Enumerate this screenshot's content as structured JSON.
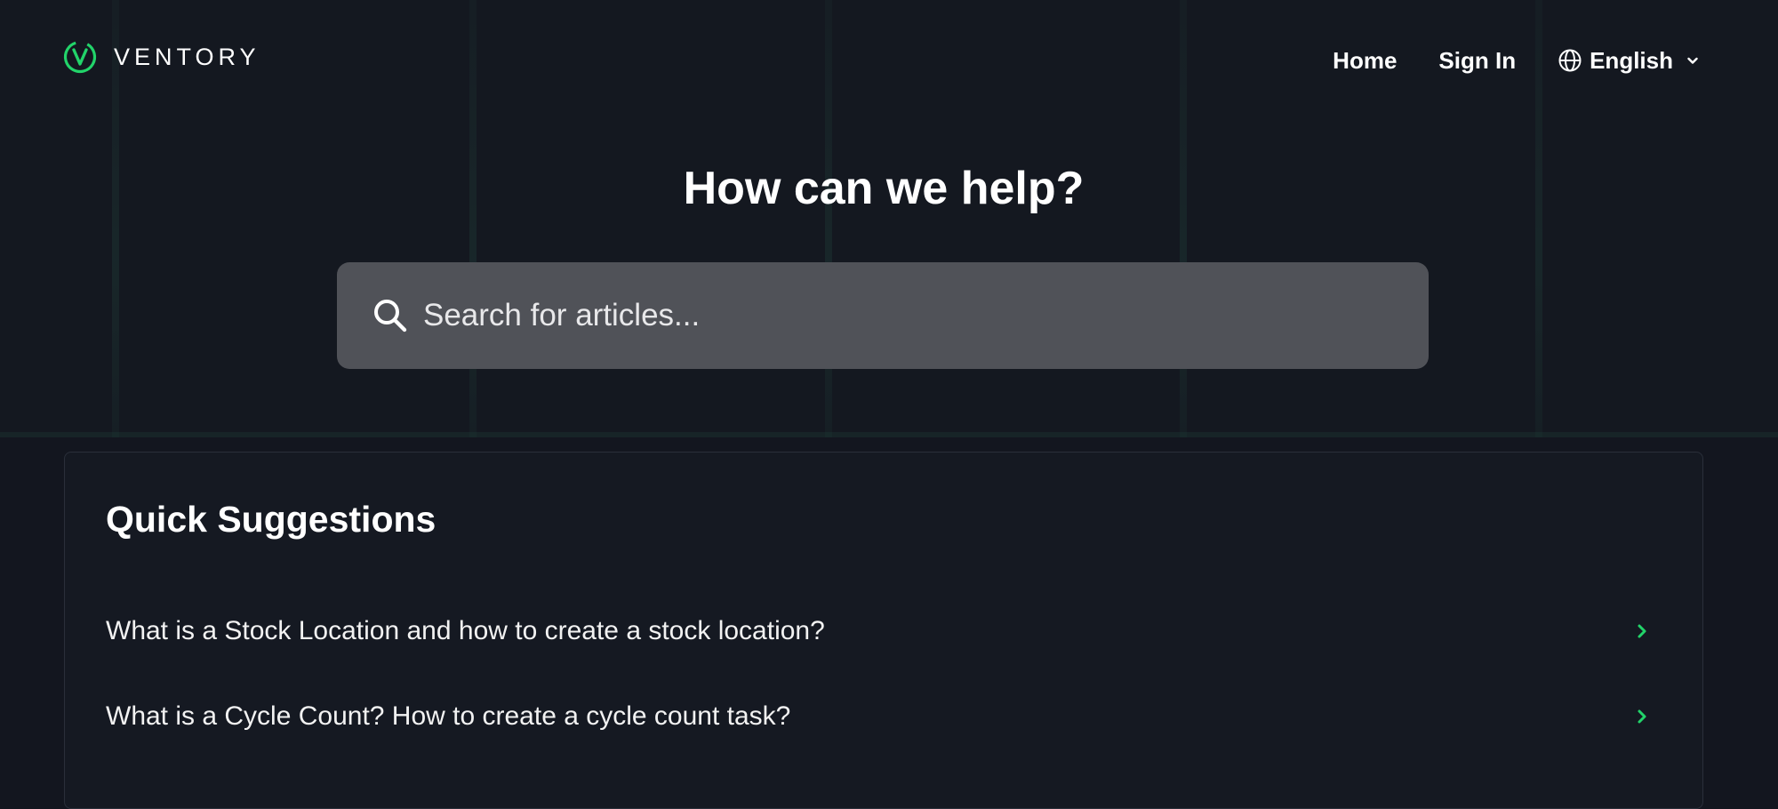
{
  "brand": {
    "name": "VENTORY",
    "accent_color": "#22d46a"
  },
  "nav": {
    "home": "Home",
    "sign_in": "Sign In",
    "language": "English",
    "language_icon": "globe-icon",
    "language_chevron_icon": "chevron-down-icon"
  },
  "hero": {
    "title": "How can we help?"
  },
  "search": {
    "placeholder": "Search for articles...",
    "value": "",
    "icon": "search-icon"
  },
  "quick_suggestions": {
    "title": "Quick Suggestions",
    "items": [
      {
        "label": "What is a Stock Location and how to create a stock location?"
      },
      {
        "label": "What is a Cycle Count? How to create a cycle count task?"
      }
    ],
    "item_icon": "chevron-right-icon"
  }
}
